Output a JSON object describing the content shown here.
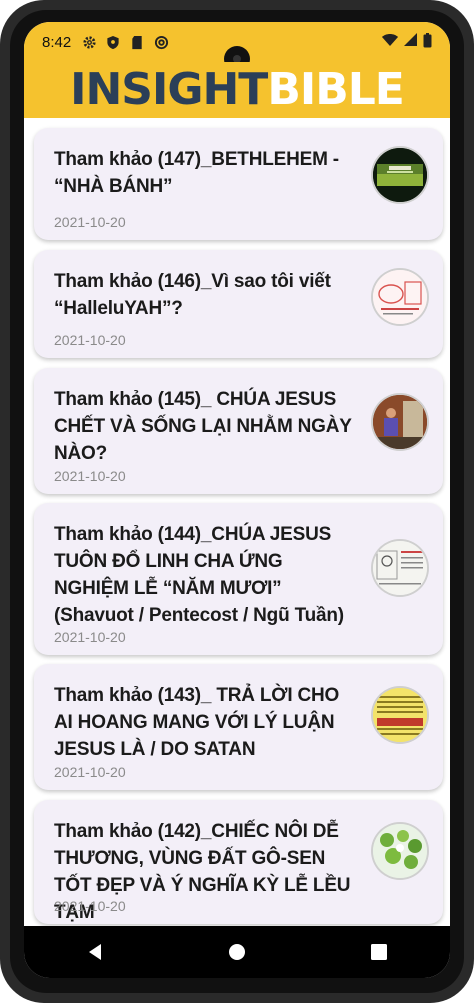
{
  "status_bar": {
    "time": "8:42",
    "left_icons": [
      "gear-icon",
      "shield-icon",
      "sim-card-icon",
      "at-sign-icon"
    ],
    "right_icons": [
      "wifi-icon",
      "signal-icon",
      "battery-icon"
    ]
  },
  "header": {
    "logo_part1": "INSIGHT",
    "logo_part2": "BIBLE",
    "background_color": "#f5c22e",
    "logo_color_dark": "#2b3f58"
  },
  "articles": [
    {
      "title": " Tham khảo (147)_BETHLEHEM - “NHÀ BÁNH”",
      "date": "2021-10-20",
      "thumb": "green-slide-thumbnail"
    },
    {
      "title": "Tham khảo (146)_Vì sao tôi viết “HalleluYAH”?",
      "date": "2021-10-20",
      "thumb": "diagram-thumbnail"
    },
    {
      "title": "Tham khảo (145)_ CHÚA JESUS CHẾT VÀ SỐNG LẠI NHẰM NGÀY NÀO?",
      "date": "2021-10-20",
      "thumb": "person-thumbnail"
    },
    {
      "title": "Tham khảo (144)_CHÚA JESUS TUÔN ĐỔ LINH CHA ỨNG NGHIỆM LỄ “NĂM MƯƠI” (Shavuot / Pentecost / Ngũ Tuần)",
      "date": "2021-10-20",
      "thumb": "chart-thumbnail"
    },
    {
      "title": "Tham khảo (143)_ TRẢ LỜI CHO AI HOANG MANG VỚI LÝ LUẬN JESUS LÀ / DO SATAN",
      "date": "2021-10-20",
      "thumb": "yellow-text-thumbnail"
    },
    {
      "title": "Tham khảo (142)_CHIẾC NÔI DỄ THƯƠNG, VÙNG ĐẤT GÔ-SEN TỐT ĐẸP VÀ Ý NGHĨA KỲ LỄ LỀU TẠM",
      "date": "2021-10-20",
      "thumb": "cradle-thumbnail"
    }
  ],
  "nav_bar": {
    "buttons": [
      "back-icon",
      "home-icon",
      "recents-icon"
    ]
  }
}
